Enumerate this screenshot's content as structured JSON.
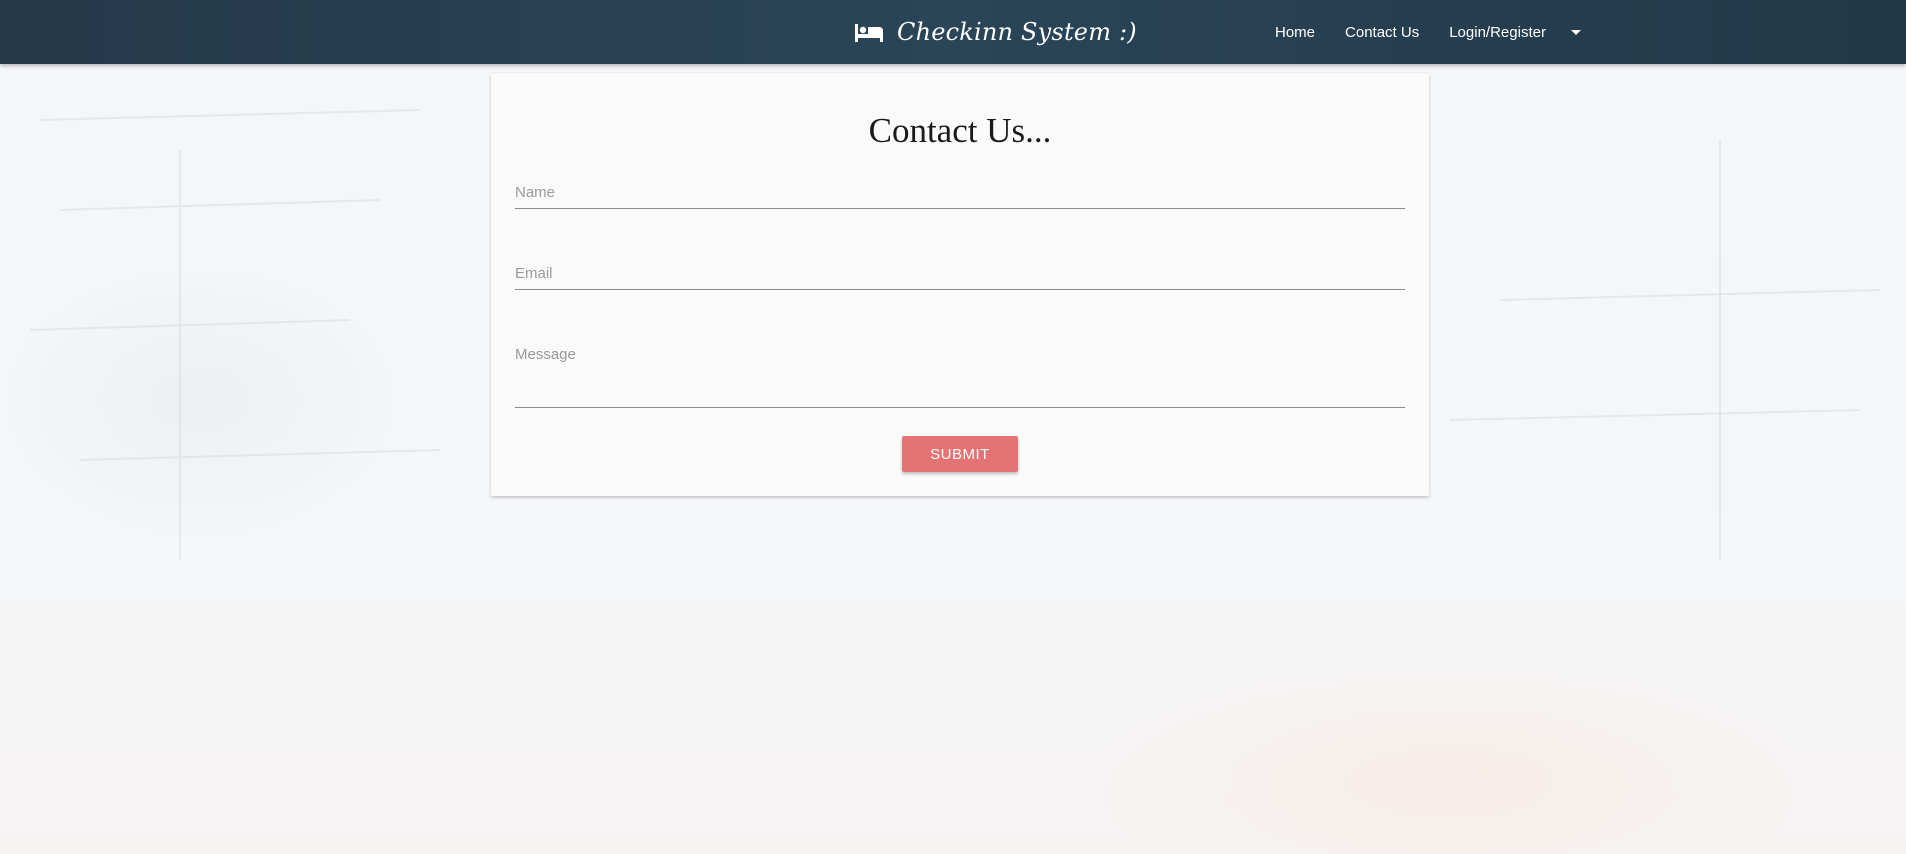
{
  "colors": {
    "navbar": "#24394a",
    "accent_button": "#e57373",
    "page_background": "#f4f6f8"
  },
  "navbar": {
    "brand_icon": "hotel-bed-icon",
    "brand_text": "Checkinn System :)",
    "links": [
      {
        "label": "Home"
      },
      {
        "label": "Contact Us"
      },
      {
        "label": "Login/Register"
      }
    ],
    "dropdown_icon": "caret-down-icon"
  },
  "contact_form": {
    "title": "Contact Us...",
    "name_placeholder": "Name",
    "email_placeholder": "Email",
    "message_placeholder": "Message",
    "submit_label": "SUBMIT"
  }
}
